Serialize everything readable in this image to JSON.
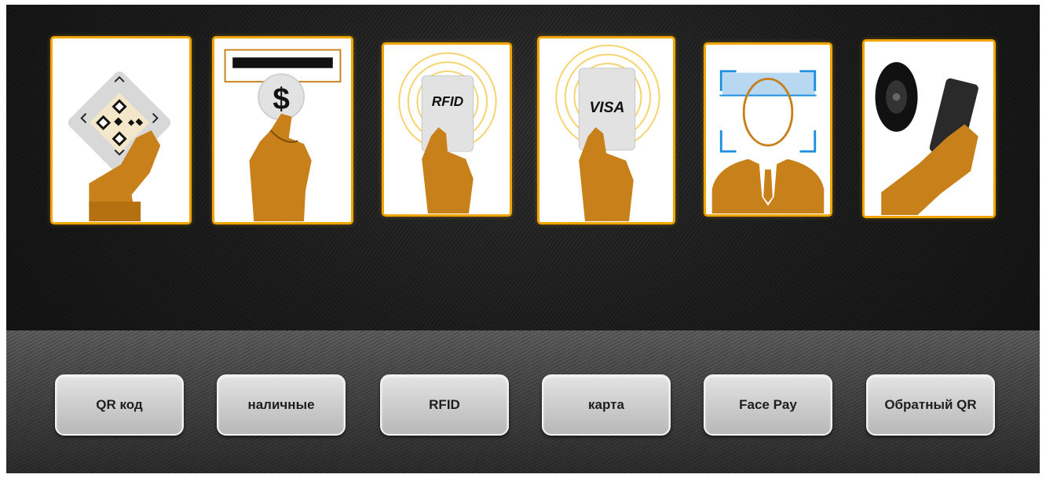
{
  "colors": {
    "accent": "#f0a500",
    "skin": "#c8801a",
    "card_bg": "#ffffff",
    "button_bg": "#cfcfcf",
    "face_frame": "#1e8fe0"
  },
  "payment_methods": [
    {
      "id": "qr",
      "button_label": "QR код",
      "icon": "qr-code-hand-icon",
      "card_text": ""
    },
    {
      "id": "cash",
      "button_label": "наличные",
      "icon": "cash-coin-hand-icon",
      "card_text": "$"
    },
    {
      "id": "rfid",
      "button_label": "RFID",
      "icon": "rfid-card-hand-icon",
      "card_text": "RFID"
    },
    {
      "id": "card",
      "button_label": "карта",
      "icon": "visa-card-hand-icon",
      "card_text": "VISA"
    },
    {
      "id": "facepay",
      "button_label": "Face Pay",
      "icon": "face-scan-icon",
      "card_text": ""
    },
    {
      "id": "reverse_qr",
      "button_label": "Обратный QR",
      "icon": "phone-scanner-icon",
      "card_text": ""
    }
  ]
}
